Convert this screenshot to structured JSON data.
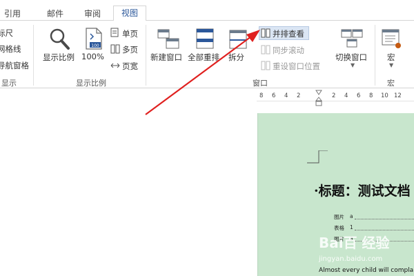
{
  "tabs": [
    {
      "label": "引用"
    },
    {
      "label": "邮件"
    },
    {
      "label": "审阅"
    },
    {
      "label": "视图"
    }
  ],
  "show_group": {
    "items": [
      "标尺",
      "网格线",
      "导航窗格"
    ],
    "label": "显示"
  },
  "zoom_group": {
    "zoom_label": "显示比例",
    "hundred_label": "100%",
    "one_page": "单页",
    "multi_page": "多页",
    "page_width": "页宽",
    "group_label": "显示比例"
  },
  "window_group": {
    "new_window": "新建窗口",
    "arrange_all": "全部重排",
    "split": "拆分",
    "side_by_side": "并排查看",
    "sync_scroll": "同步滚动",
    "reset_position": "重设窗口位置",
    "switch_window": "切换窗口",
    "group_label": "窗口"
  },
  "macro_group": {
    "macro": "宏",
    "group_label": "宏"
  },
  "ruler": {
    "ticks": [
      "8",
      "6",
      "4",
      "2",
      "2",
      "4",
      "6",
      "8",
      "10",
      "12"
    ]
  },
  "document": {
    "title": "·标题：测试文档",
    "toc": [
      {
        "label": "图片",
        "page": "a"
      },
      {
        "label": "表格",
        "page": "1"
      },
      {
        "label": "图片",
        "page": "a"
      }
    ],
    "body_text": "Almost every child will complain",
    "watermark": "Bai百 经验",
    "watermark_url": "jingyan.baidu.com"
  },
  "colors": {
    "accent": "#2b579a",
    "page_bg": "#c8e6cd",
    "highlight": "#dbe6f4",
    "arrow": "#e0201f"
  }
}
